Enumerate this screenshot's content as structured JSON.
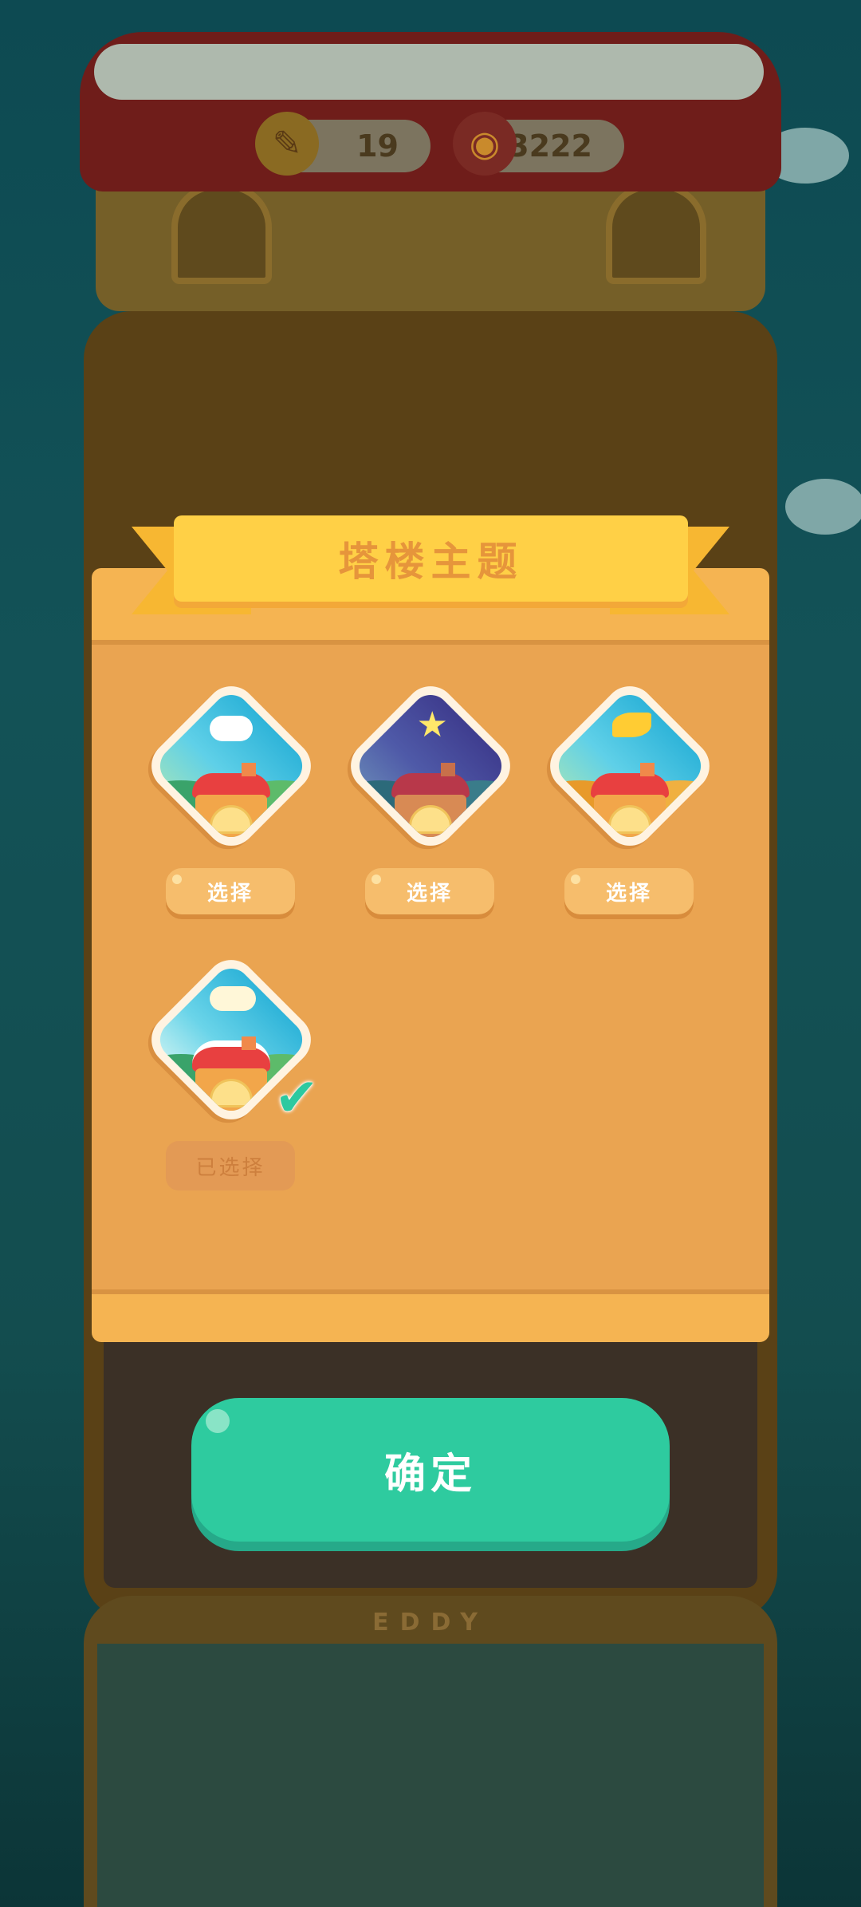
{
  "resources": {
    "pencil_count": "19",
    "can_count": "3222"
  },
  "background": {
    "floor_sign": "EDDY"
  },
  "modal": {
    "title": "塔楼主题",
    "themes": [
      {
        "icon": "sunny-day-theme-icon",
        "button_label": "选择"
      },
      {
        "icon": "starry-night-theme-icon",
        "button_label": "选择"
      },
      {
        "icon": "autumn-leaf-theme-icon",
        "button_label": "选择"
      },
      {
        "icon": "snowy-winter-theme-icon",
        "button_label": "已选择",
        "selected": true
      }
    ]
  },
  "confirm_button": {
    "label": "确定"
  },
  "colors": {
    "confirm": "#2ecb9f",
    "ribbon": "#ffd046",
    "panel": "#eaa451"
  }
}
